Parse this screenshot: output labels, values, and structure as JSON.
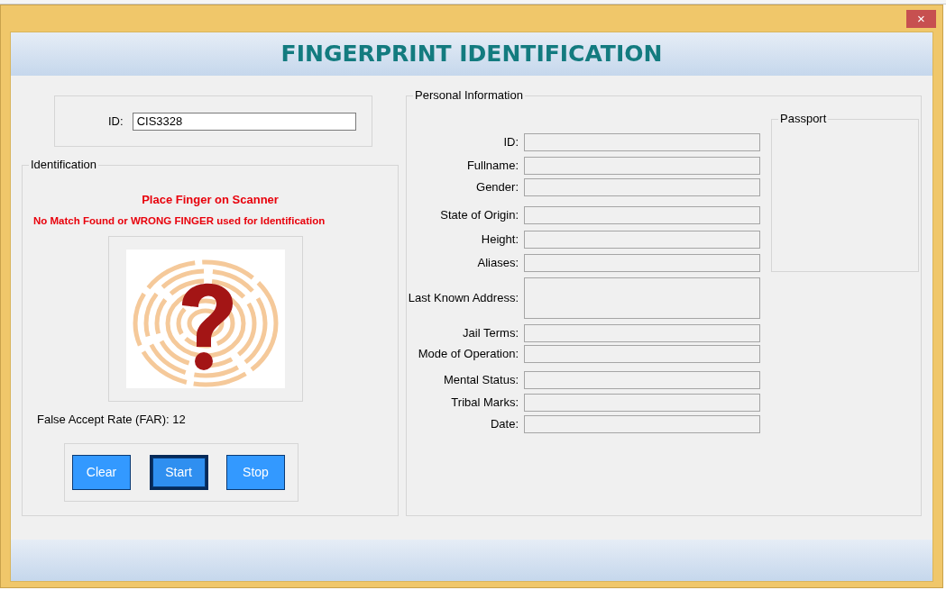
{
  "window": {
    "title": "FINGERPRINT IDENTIFICATION",
    "close": "×"
  },
  "search": {
    "label": "ID:",
    "value": "CIS3328"
  },
  "identification": {
    "legend": "Identification",
    "prompt": "Place Finger on Scanner",
    "result": "No Match Found or WRONG FINGER used for Identification",
    "far": "False Accept Rate (FAR): 12",
    "buttons": [
      {
        "label": "Clear",
        "focused": false
      },
      {
        "label": "Start",
        "focused": true
      },
      {
        "label": "Stop",
        "focused": false
      }
    ]
  },
  "personal": {
    "legend": "Personal Information",
    "fields": [
      {
        "label": "ID:",
        "kind": "line"
      },
      {
        "label": "Fullname:",
        "kind": "line"
      },
      {
        "label": "Gender:",
        "kind": "line"
      },
      {
        "label": "State of Origin:",
        "kind": "line"
      },
      {
        "label": "Height:",
        "kind": "line"
      },
      {
        "label": "Aliases:",
        "kind": "line"
      },
      {
        "label": "Last Known Address:",
        "kind": "area"
      },
      {
        "label": "Jail Terms:",
        "kind": "line"
      },
      {
        "label": "Mode of Operation:",
        "kind": "line"
      },
      {
        "label": "Mental Status:",
        "kind": "line"
      },
      {
        "label": "Tribal Marks:",
        "kind": "line"
      },
      {
        "label": "Date:",
        "kind": "line"
      }
    ],
    "passport": {
      "legend": "Passport"
    }
  }
}
